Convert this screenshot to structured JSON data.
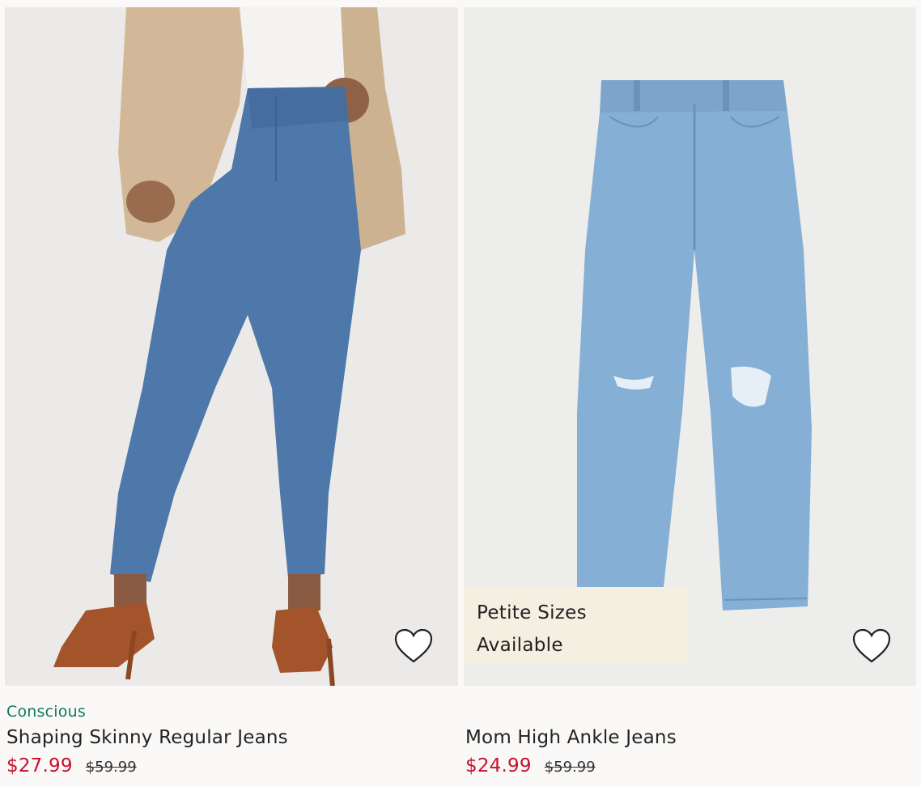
{
  "products": [
    {
      "tag": "Conscious",
      "title": "Shaping Skinny Regular Jeans",
      "sale_price": "$27.99",
      "original_price": "$59.99",
      "badge": ""
    },
    {
      "tag": "",
      "title": "Mom High Ankle Jeans",
      "sale_price": "$24.99",
      "original_price": "$59.99",
      "badge_line1": "Petite Sizes",
      "badge_line2": "Available"
    }
  ],
  "colors": {
    "sale_price": "#c8102e",
    "conscious_tag": "#0e7a5c",
    "badge_bg": "#f5efe2",
    "page_bg": "#faf9f8"
  },
  "icons": {
    "favorite": "heart-outline-icon"
  }
}
